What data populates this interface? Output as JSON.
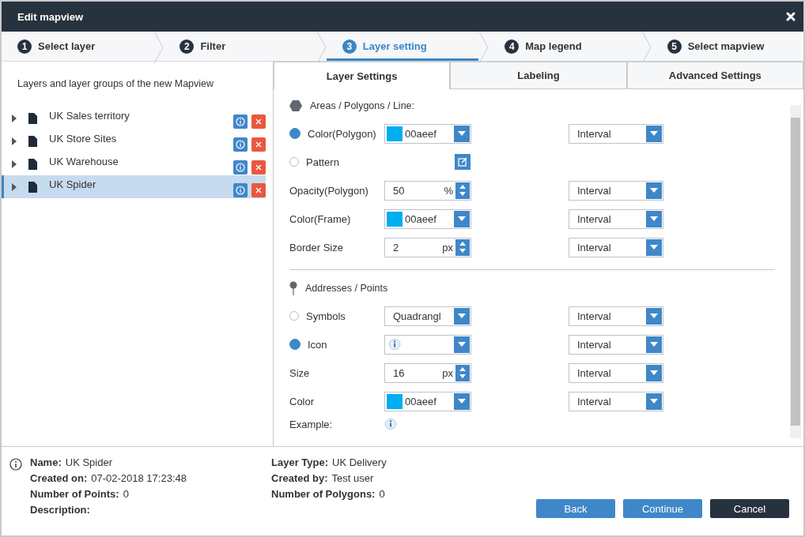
{
  "window": {
    "title": "Edit mapview"
  },
  "steps": [
    {
      "number": "1",
      "label": "Select layer",
      "selected": false
    },
    {
      "number": "2",
      "label": "Filter",
      "selected": false
    },
    {
      "number": "3",
      "label": "Layer setting",
      "selected": true
    },
    {
      "number": "4",
      "label": "Map legend",
      "selected": false
    },
    {
      "number": "5",
      "label": "Select mapview",
      "selected": false
    }
  ],
  "sidebar": {
    "heading": "Layers and layer groups of the new Mapview",
    "items": [
      {
        "label": "UK Sales territory",
        "selected": false
      },
      {
        "label": "UK Store Sites",
        "selected": false
      },
      {
        "label": "UK Warehouse",
        "selected": false
      },
      {
        "label": "UK Spider",
        "selected": true
      }
    ]
  },
  "tabs": [
    {
      "label": "Layer Settings",
      "selected": true
    },
    {
      "label": "Labeling",
      "selected": false
    },
    {
      "label": "Advanced Settings",
      "selected": false
    }
  ],
  "sections": [
    {
      "kind": "polygon",
      "title": "Areas / Polygons / Line:",
      "rows": [
        {
          "kind": "color",
          "label": "Color(Polygon)",
          "selected": true,
          "color": "#00aeef",
          "value": "00aeef",
          "mode": "Interval"
        },
        {
          "kind": "edit",
          "label": "Pattern",
          "selected": false
        },
        {
          "kind": "number",
          "label": "Opacity(Polygon)",
          "value": "50",
          "unit": "%",
          "mode": "Interval"
        },
        {
          "kind": "color",
          "label": "Color(Frame)",
          "color": "#00aeef",
          "value": "00aeef",
          "mode": "Interval"
        },
        {
          "kind": "number",
          "label": "Border Size",
          "value": "2",
          "unit": "px",
          "mode": "Interval"
        }
      ]
    },
    {
      "kind": "point",
      "title": "Addresses / Points",
      "rows": [
        {
          "kind": "select",
          "label": "Symbols",
          "selected": false,
          "value": "Quadrangl",
          "mode": "Interval"
        },
        {
          "kind": "icon",
          "label": "Icon",
          "selected": true,
          "mode": "Interval"
        },
        {
          "kind": "number",
          "label": "Size",
          "value": "16",
          "unit": "px",
          "mode": "Interval"
        },
        {
          "kind": "color",
          "label": "Color",
          "color": "#00aeef",
          "value": "00aeef",
          "mode": "Interval"
        },
        {
          "kind": "example",
          "label": "Example:"
        }
      ]
    }
  ],
  "details": [
    {
      "label": "Name:",
      "value": "UK Spider"
    },
    {
      "label": "Created on:",
      "value": "07-02-2018 17:23:48"
    },
    {
      "label": "Number of Points:",
      "value": "0"
    },
    {
      "label": "Description:"
    },
    {
      "label": "Layer Type:",
      "value": "UK Delivery"
    },
    {
      "label": "Created by:",
      "value": "Test user"
    },
    {
      "label": "Number of Polygons:",
      "value": "0"
    }
  ],
  "buttons": [
    {
      "kind": "primary",
      "label": "Back"
    },
    {
      "kind": "primary",
      "label": "Continue"
    },
    {
      "kind": "dark",
      "label": "Cancel"
    }
  ]
}
